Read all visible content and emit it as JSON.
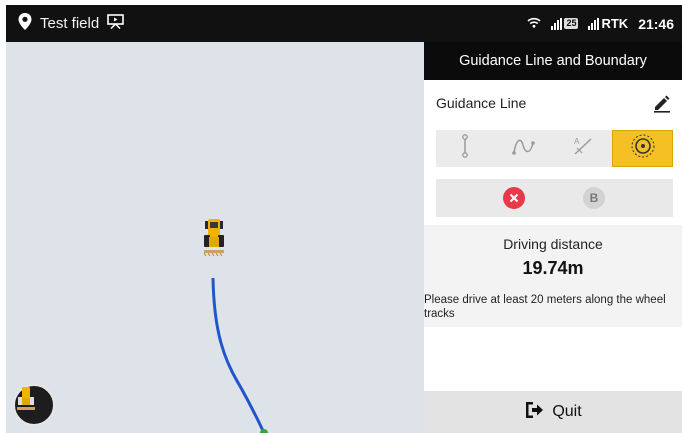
{
  "statusbar": {
    "location_icon": "location-pin-icon",
    "field_name": "Test field",
    "screen_icon": "presentation-icon",
    "wifi_icon": "wifi-icon",
    "satellite_count": "25",
    "rtk_label": "RTK",
    "time": "21:46"
  },
  "panel": {
    "title": "Guidance Line and Boundary",
    "guidance_label": "Guidance Line",
    "edit_icon": "pencil-icon",
    "modes": [
      {
        "name": "straight-line",
        "icon": "straight-ab-line-icon",
        "active": false
      },
      {
        "name": "curve",
        "icon": "curve-line-icon",
        "active": false
      },
      {
        "name": "a-plus",
        "icon": "a-plus-heading-icon",
        "active": false
      },
      {
        "name": "pivot",
        "icon": "pivot-circle-icon",
        "active": true
      }
    ],
    "a_point_icon": "close-x-icon",
    "b_point_label": "B",
    "distance_label": "Driving distance",
    "distance_value": "19.74m",
    "hint": "Please drive at least 20 meters along the wheel tracks",
    "quit_label": "Quit",
    "quit_icon": "exit-arrow-icon"
  },
  "map": {
    "vehicle_icon": "tractor-icon",
    "recenter_icon": "tractor-locate-icon",
    "track_color": "#2156c9",
    "background": "#dee3ea"
  },
  "colors": {
    "accent": "#f5c024",
    "danger": "#e8394b"
  }
}
